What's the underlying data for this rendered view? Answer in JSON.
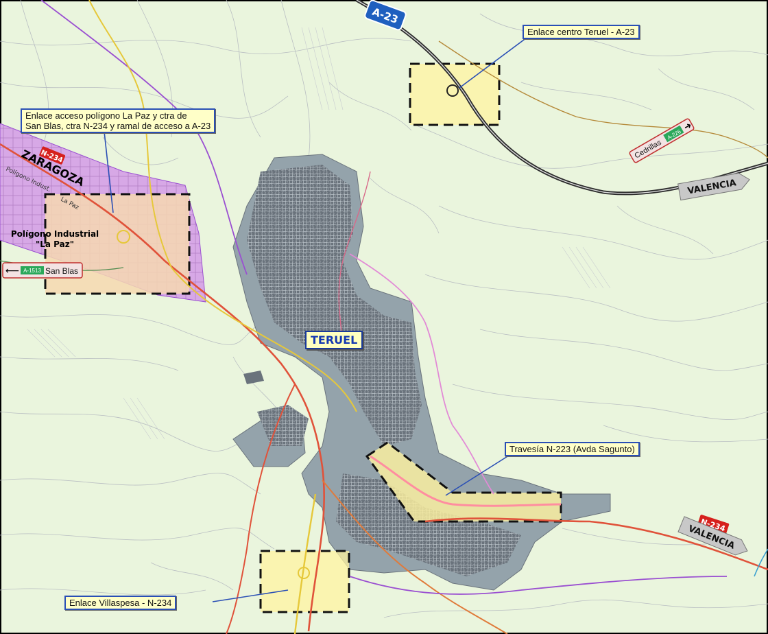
{
  "map": {
    "city_label": "TERUEL",
    "callouts": {
      "centro": "Enlace centro Teruel - A-23",
      "lapaz_line1": "Enlace acceso polígono La Paz y ctra de",
      "lapaz_line2": "San Blas, ctra N-234 y ramal de acceso a A-23",
      "travesia": "Travesía N-223 (Avda Sagunto)",
      "villaspesa": "Enlace Villaspesa - N-234"
    },
    "area_label_line1": "Polígono Industrial",
    "area_label_line2": "\"La Paz\"",
    "road_shields": {
      "motorway": "A-23",
      "national_nw": "N-234",
      "national_se": "N-234"
    },
    "direction_signs": {
      "zaragoza": "ZARAGOZA",
      "valencia_east": "VALENCIA",
      "valencia_se": "VALENCIA",
      "cedrillas": "Cedrillas",
      "cedrillas_code": "A-226",
      "san_blas": "San Blas",
      "san_blas_code": "A-1513"
    },
    "street_labels": {
      "poligono_small": "Polígono Indust.",
      "la_paz_small": "La Paz"
    },
    "colors": {
      "background": "#eaf5dd",
      "urban_area": "#8e9ea6",
      "urban_dense": "#5d6670",
      "study_zone": "#fff3a0",
      "industrial": "#d9a9e4",
      "motorway": "#3a3a3a",
      "national_road": "#e0523a",
      "regional_yellow": "#e6c83a",
      "purple_road": "#9a4fd1",
      "pink_road": "#e28ad6",
      "callout_border": "#2a4fb5"
    }
  }
}
